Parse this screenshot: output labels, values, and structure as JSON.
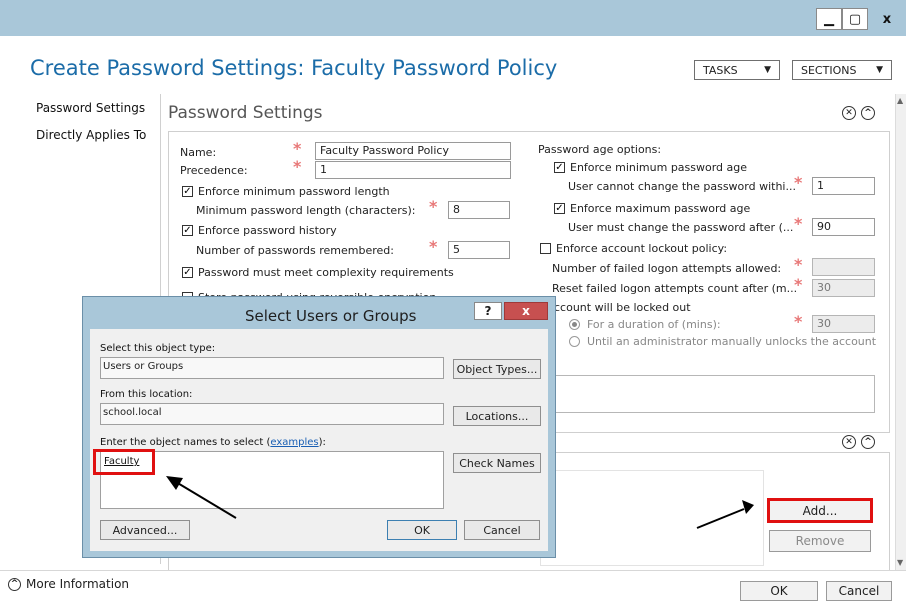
{
  "window": {
    "minimize_glyph": "▁",
    "maximize_glyph": "▢",
    "close_glyph": "x"
  },
  "header": {
    "title": "Create Password Settings: Faculty Password Policy",
    "tasks_label": "TASKS",
    "sections_label": "SECTIONS"
  },
  "nav": {
    "items": [
      {
        "label": "Password Settings"
      },
      {
        "label": "Directly Applies To"
      }
    ]
  },
  "section": {
    "title": "Password Settings"
  },
  "form": {
    "name_label": "Name:",
    "name_value": "Faculty Password Policy",
    "precedence_label": "Precedence:",
    "precedence_value": "1",
    "enforce_min_length_label": "Enforce minimum password length",
    "min_length_label": "Minimum password length (characters):",
    "min_length_value": "8",
    "enforce_history_label": "Enforce password history",
    "history_label": "Number of passwords remembered:",
    "history_value": "5",
    "complexity_label": "Password must meet complexity requirements",
    "reversible_label": "Store password using reversible encryption",
    "age_options_label": "Password age options:",
    "enforce_min_age_label": "Enforce minimum password age",
    "min_age_label": "User cannot change the password withi...",
    "min_age_value": "1",
    "enforce_max_age_label": "Enforce maximum password age",
    "max_age_label": "User must change the password after (...",
    "max_age_value": "90",
    "lockout_label": "Enforce account lockout policy:",
    "failed_attempts_label": "Number of failed logon attempts allowed:",
    "failed_attempts_value": "",
    "reset_count_label": "Reset failed logon attempts count after (m...",
    "reset_count_value": "30",
    "locked_out_label": "ccount will be locked out",
    "duration_label": "For a duration of (mins):",
    "duration_value": "30",
    "until_admin_label": "Until an administrator manually unlocks the account"
  },
  "applies_to": {
    "add_label": "Add...",
    "remove_label": "Remove"
  },
  "dialog": {
    "title": "Select Users or Groups",
    "help_label": "?",
    "close_label": "x",
    "object_type_label": "Select this object type:",
    "object_type_value": "Users or Groups",
    "object_types_button": "Object Types...",
    "location_label": "From this location:",
    "location_value": "school.local",
    "locations_button": "Locations...",
    "enter_names_prefix": "Enter the object names to select (",
    "examples_link": "examples",
    "enter_names_suffix": "):",
    "names_value": "Faculty",
    "check_names_button": "Check Names",
    "advanced_button": "Advanced...",
    "ok_button": "OK",
    "cancel_button": "Cancel"
  },
  "footer": {
    "more_info_label": "More Information",
    "ok_label": "OK",
    "cancel_label": "Cancel"
  },
  "colors": {
    "title_bar": "#a9c7d9",
    "title_text": "#1b6ca8",
    "highlight_red": "#e01010",
    "dialog_close": "#c75050"
  }
}
